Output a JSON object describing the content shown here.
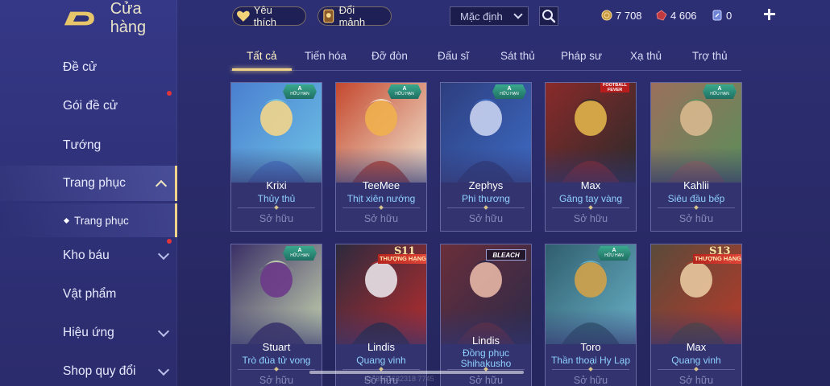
{
  "header": {
    "title": "Cửa hàng",
    "favorite_label": "Yêu thích",
    "exchange_label": "Đổi mảnh",
    "sort_value": "Mặc định",
    "currencies": [
      {
        "icon": "gold-coin-icon",
        "value": "7 708"
      },
      {
        "icon": "red-gem-icon",
        "value": "4 606"
      },
      {
        "icon": "voucher-icon",
        "value": "0"
      }
    ]
  },
  "sidebar": {
    "items": [
      {
        "label": "Đề cử"
      },
      {
        "label": "Gói đề cử"
      },
      {
        "label": "Tướng"
      },
      {
        "label": "Trang phục"
      },
      {
        "label": "Kho báu"
      },
      {
        "label": "Vật phẩm"
      },
      {
        "label": "Hiệu ứng"
      },
      {
        "label": "Shop quy đổi"
      }
    ],
    "sub_item": "Trang phục"
  },
  "tabs": [
    "Tất cả",
    "Tiến hóa",
    "Đỡ đòn",
    "Đấu sĩ",
    "Sát thủ",
    "Pháp sư",
    "Xạ thủ",
    "Trợ thủ"
  ],
  "badges": {
    "grade_letter": "A",
    "grade_text": "HỮU HẠN",
    "ss_label": "THƯỢNG HẠNG",
    "s11": "S11",
    "s13": "S13",
    "bleach": "BLEACH",
    "football": "FOOTBALL FEVER"
  },
  "cards": [
    {
      "name": "Krixi",
      "skin": "Thủy thủ",
      "status": "Sở hữu",
      "palette": [
        "#4a7fd0",
        "#f2d58a",
        "#6ec4e6"
      ],
      "badge": "a"
    },
    {
      "name": "TeeMee",
      "skin": "Thịt xiên nướng",
      "status": "Sở hữu",
      "palette": [
        "#c4482e",
        "#f0b04e",
        "#f3e7d2"
      ],
      "badge": "a"
    },
    {
      "name": "Zephys",
      "skin": "Phi thương",
      "status": "Sở hữu",
      "palette": [
        "#2d3e7e",
        "#c8d2ef",
        "#3d6bc4"
      ],
      "badge": "a"
    },
    {
      "name": "Max",
      "skin": "Găng tay vàng",
      "status": "Sở hữu",
      "palette": [
        "#8a2a2a",
        "#e0b24a",
        "#2a2a2a"
      ],
      "badge": "ff"
    },
    {
      "name": "Kahlii",
      "skin": "Siêu đầu bếp",
      "status": "Sở hữu",
      "palette": [
        "#9a6f5c",
        "#d8b88e",
        "#5a8f5a"
      ],
      "badge": "a"
    },
    {
      "name": "Stuart",
      "skin": "Trò đùa tử vong",
      "status": "Sở hữu",
      "palette": [
        "#3a2f66",
        "#6c3a8a",
        "#c8d6b0"
      ],
      "badge": "a"
    },
    {
      "name": "Lindis",
      "skin": "Quang vinh",
      "status": "Sở hữu",
      "palette": [
        "#2c2a3e",
        "#e8e2e8",
        "#b82d2d"
      ],
      "badge": "s11"
    },
    {
      "name": "Lindis",
      "skin": "Đồng phục Shihakusho",
      "status": "Sở hữu",
      "palette": [
        "#6a2e3a",
        "#e6b6a6",
        "#2a2a4a"
      ],
      "badge": "bleach"
    },
    {
      "name": "Toro",
      "skin": "Thần thoại Hy Lạp",
      "status": "Sở hữu",
      "palette": [
        "#2f5e6e",
        "#d2a24a",
        "#6ab2c8"
      ],
      "badge": "a"
    },
    {
      "name": "Max",
      "skin": "Quang vinh",
      "status": "Sở hữu",
      "palette": [
        "#5a4a3a",
        "#e8c89e",
        "#b83a2a"
      ],
      "badge": "s13"
    }
  ],
  "watermark": "ID: 3561632318 7745",
  "colors": {
    "accent_gold": "#f0d48a",
    "skin_name_blue": "#8fd0ff",
    "notification_red": "#e2353b",
    "owned_gray": "#8588b8"
  }
}
